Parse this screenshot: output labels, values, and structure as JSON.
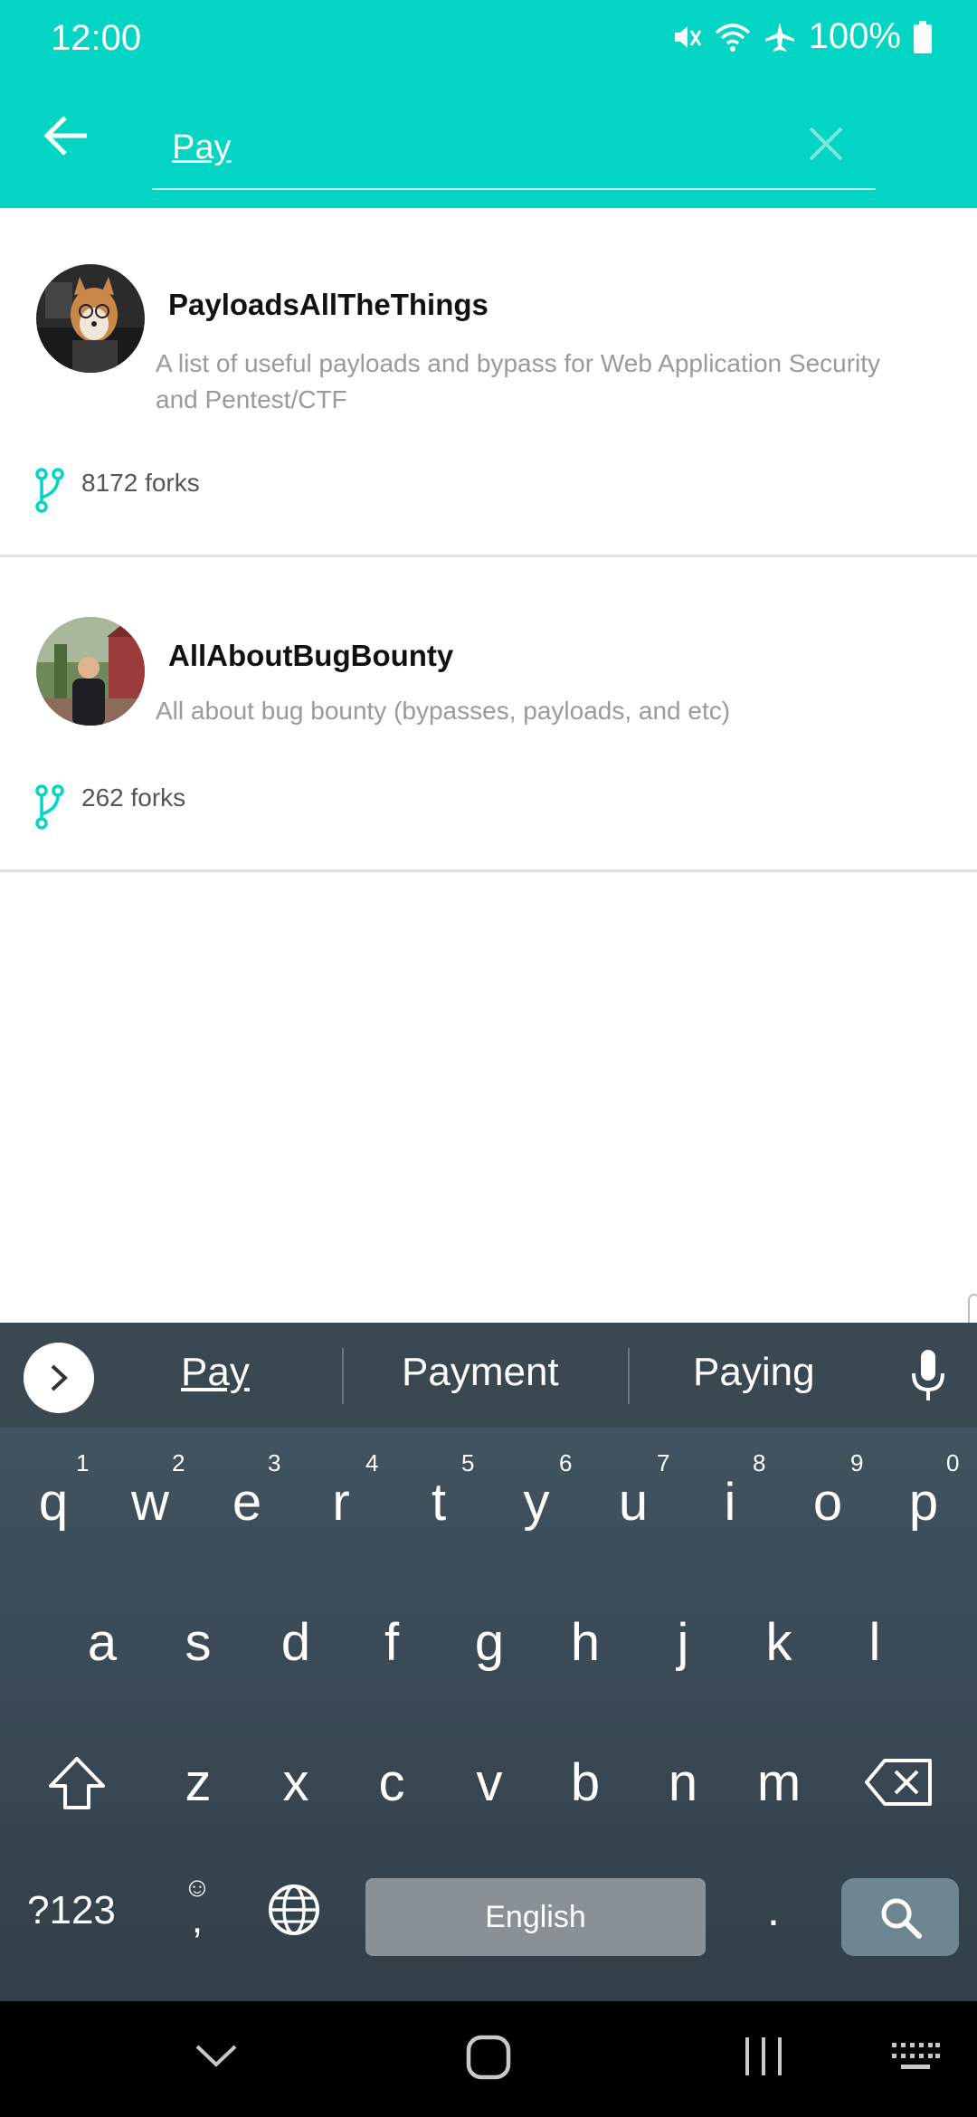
{
  "status_bar": {
    "time": "12:00",
    "battery": "100%",
    "icons": [
      "mute-icon",
      "wifi-icon",
      "airplane-icon",
      "battery-icon"
    ]
  },
  "toolbar": {
    "search_value": "Pay",
    "accent_color": "#03D5C4"
  },
  "results": [
    {
      "name": "PayloadsAllTheThings",
      "description": "A list of useful payloads and bypass for Web Application Security and Pentest/CTF",
      "forks": "8172 forks"
    },
    {
      "name": "AllAboutBugBounty",
      "description": "All about bug bounty (bypasses, payloads, and etc)",
      "forks": "262 forks"
    }
  ],
  "keyboard": {
    "suggestions": [
      "Pay",
      "Payment",
      "Paying"
    ],
    "row1": [
      "q",
      "w",
      "e",
      "r",
      "t",
      "y",
      "u",
      "i",
      "o",
      "p"
    ],
    "row1_hints": [
      "1",
      "2",
      "3",
      "4",
      "5",
      "6",
      "7",
      "8",
      "9",
      "0"
    ],
    "row2": [
      "a",
      "s",
      "d",
      "f",
      "g",
      "h",
      "j",
      "k",
      "l"
    ],
    "row3": [
      "z",
      "x",
      "c",
      "v",
      "b",
      "n",
      "m"
    ],
    "symbols_label": "?123",
    "comma": ",",
    "emoji": "☺",
    "space_label": "English",
    "period": "."
  }
}
